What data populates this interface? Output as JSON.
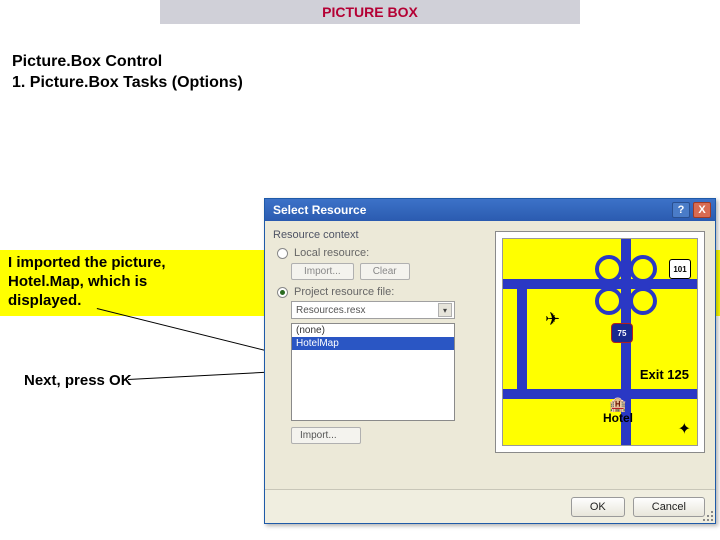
{
  "banner": {
    "title": "PICTURE BOX"
  },
  "subtitle": {
    "line1": "Picture.Box Control",
    "line2": "1.  Picture.Box Tasks (Options)"
  },
  "note": "I imported the picture, Hotel.Map, which is displayed.",
  "next": "Next, press OK",
  "dialog": {
    "title": "Select Resource",
    "help_icon": "?",
    "close_icon": "X",
    "group_label": "Resource context",
    "radio_local": "Local resource:",
    "btn_import_top": "Import...",
    "btn_clear": "Clear",
    "radio_project": "Project resource file:",
    "combo_value": "Resources.resx",
    "list": {
      "item0": "(none)",
      "item1": "HotelMap"
    },
    "btn_import_bottom": "Import...",
    "ok": "OK",
    "cancel": "Cancel"
  },
  "map": {
    "shield_route": "101",
    "shield_interstate": "75",
    "exit": "Exit 125",
    "hotel": "Hotel"
  }
}
